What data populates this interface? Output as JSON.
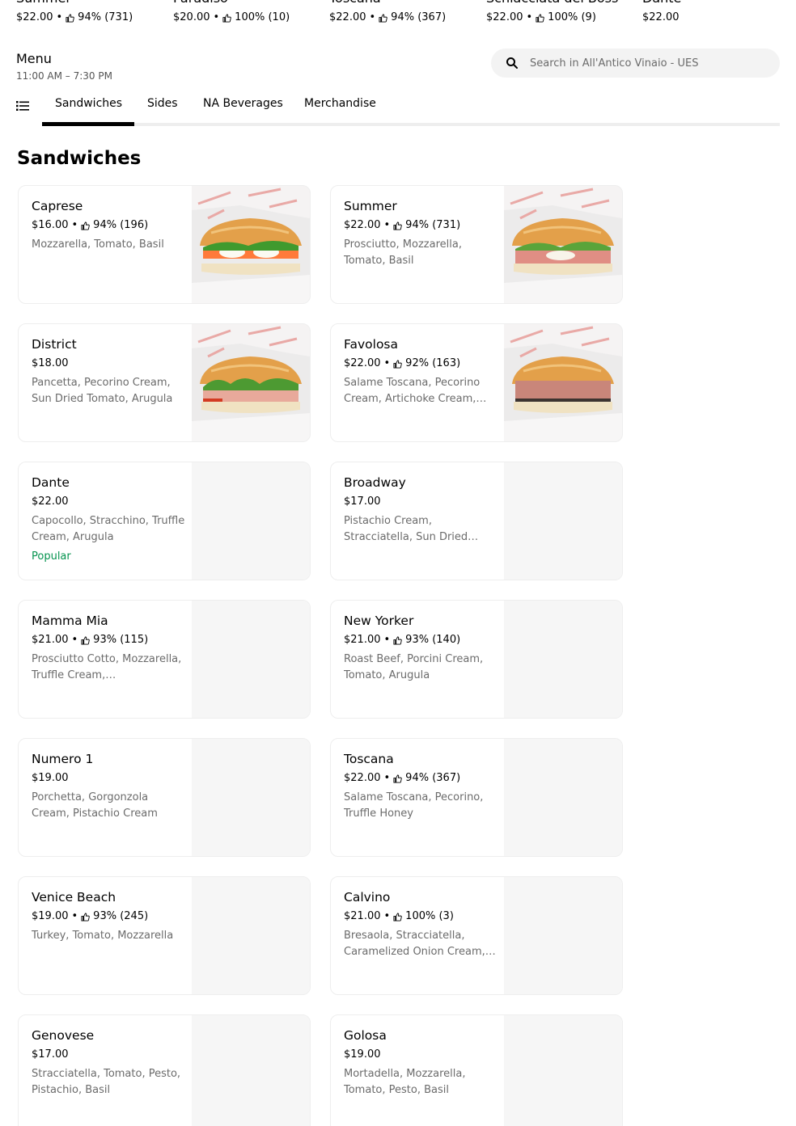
{
  "top_items": [
    {
      "name": "Summer",
      "price": "$22.00",
      "rating": "94% (731)"
    },
    {
      "name": "Paradiso",
      "price": "$20.00",
      "rating": "100% (10)"
    },
    {
      "name": "Toscana",
      "price": "$22.00",
      "rating": "94% (367)"
    },
    {
      "name": "Schiacciata del Boss",
      "price": "$22.00",
      "rating": "100% (9)"
    },
    {
      "name": "Dante",
      "price": "$22.00",
      "rating": ""
    }
  ],
  "menu": {
    "title": "Menu",
    "hours": "11:00 AM – 7:30 PM"
  },
  "search": {
    "placeholder": "Search in All'Antico Vinaio - UES"
  },
  "tabs": [
    {
      "label": "Sandwiches"
    },
    {
      "label": "Sides"
    },
    {
      "label": "NA Beverages"
    },
    {
      "label": "Merchandise"
    }
  ],
  "section": {
    "title": "Sandwiches"
  },
  "items": [
    {
      "name": "Caprese",
      "price": "$16.00",
      "rating": "94% (196)",
      "desc": "Mozzarella, Tomato, Basil",
      "badge": ""
    },
    {
      "name": "Summer",
      "price": "$22.00",
      "rating": "94% (731)",
      "desc": "Prosciutto, Mozzarella, Tomato, Basil",
      "badge": ""
    },
    {
      "name": "District",
      "price": "$18.00",
      "rating": "",
      "desc": "Pancetta, Pecorino Cream, Sun Dried Tomato, Arugula",
      "badge": ""
    },
    {
      "name": "Favolosa",
      "price": "$22.00",
      "rating": "92% (163)",
      "desc": "Salame Toscana, Pecorino Cream, Artichoke Cream,…",
      "badge": ""
    },
    {
      "name": "Dante",
      "price": "$22.00",
      "rating": "",
      "desc": "Capocollo, Stracchino, Truffle Cream, Arugula",
      "badge": "Popular"
    },
    {
      "name": "Broadway",
      "price": "$17.00",
      "rating": "",
      "desc": "Pistachio Cream, Stracciatella, Sun Dried…",
      "badge": ""
    },
    {
      "name": "Mamma Mia",
      "price": "$21.00",
      "rating": "93% (115)",
      "desc": "Prosciutto Cotto, Mozzarella, Truffle Cream,…",
      "badge": ""
    },
    {
      "name": "New Yorker",
      "price": "$21.00",
      "rating": "93% (140)",
      "desc": "Roast Beef, Porcini Cream, Tomato, Arugula",
      "badge": ""
    },
    {
      "name": "Numero 1",
      "price": "$19.00",
      "rating": "",
      "desc": "Porchetta, Gorgonzola Cream, Pistachio Cream",
      "badge": ""
    },
    {
      "name": "Toscana",
      "price": "$22.00",
      "rating": "94% (367)",
      "desc": "Salame Toscana, Pecorino, Truffle Honey",
      "badge": ""
    },
    {
      "name": "Venice Beach",
      "price": "$19.00",
      "rating": "93% (245)",
      "desc": "Turkey, Tomato, Mozzarella",
      "badge": ""
    },
    {
      "name": "Calvino",
      "price": "$21.00",
      "rating": "100% (3)",
      "desc": "Bresaola, Stracciatella, Caramelized Onion Cream,…",
      "badge": ""
    },
    {
      "name": "Genovese",
      "price": "$17.00",
      "rating": "",
      "desc": "Stracciatella, Tomato, Pesto, Pistachio, Basil",
      "badge": ""
    },
    {
      "name": "Golosa",
      "price": "$19.00",
      "rating": "",
      "desc": "Mortadella, Mozzarella, Tomato, Pesto, Basil",
      "badge": ""
    }
  ],
  "colors": {
    "popular": "#05944f",
    "muted": "#6b6b6b",
    "active_tab": "#000000"
  }
}
